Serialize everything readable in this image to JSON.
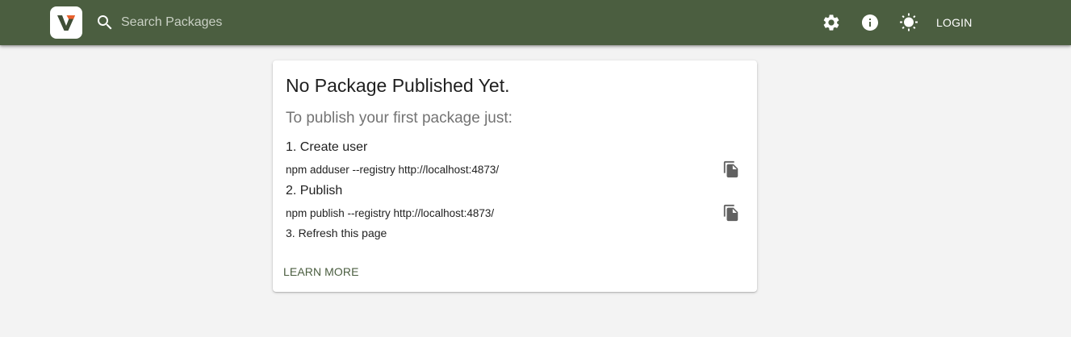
{
  "header": {
    "logo_icon": "verdaccio-logo-icon",
    "search": {
      "icon": "search-icon",
      "placeholder": "Search Packages",
      "value": ""
    },
    "icons": [
      "gear-icon",
      "info-icon",
      "sun-icon"
    ],
    "login_label": "LOGIN"
  },
  "card": {
    "title": "No Package Published Yet.",
    "subtitle": "To publish your first package just:",
    "steps": [
      {
        "heading": "1. Create user",
        "command": "npm adduser --registry http://localhost:4873/",
        "copy_icon": "copy-icon"
      },
      {
        "heading": "2. Publish",
        "command": "npm publish --registry http://localhost:4873/",
        "copy_icon": "copy-icon"
      },
      {
        "heading": "3. Refresh this page"
      }
    ],
    "learn_more_label": "LEARN MORE"
  },
  "colors": {
    "header_background": "#4b5e40",
    "page_background": "#f3f3f3",
    "card_background": "#ffffff",
    "link_accent": "#4b5e40",
    "logo_orange": "#e8602c",
    "logo_dark": "#3f4e36"
  }
}
